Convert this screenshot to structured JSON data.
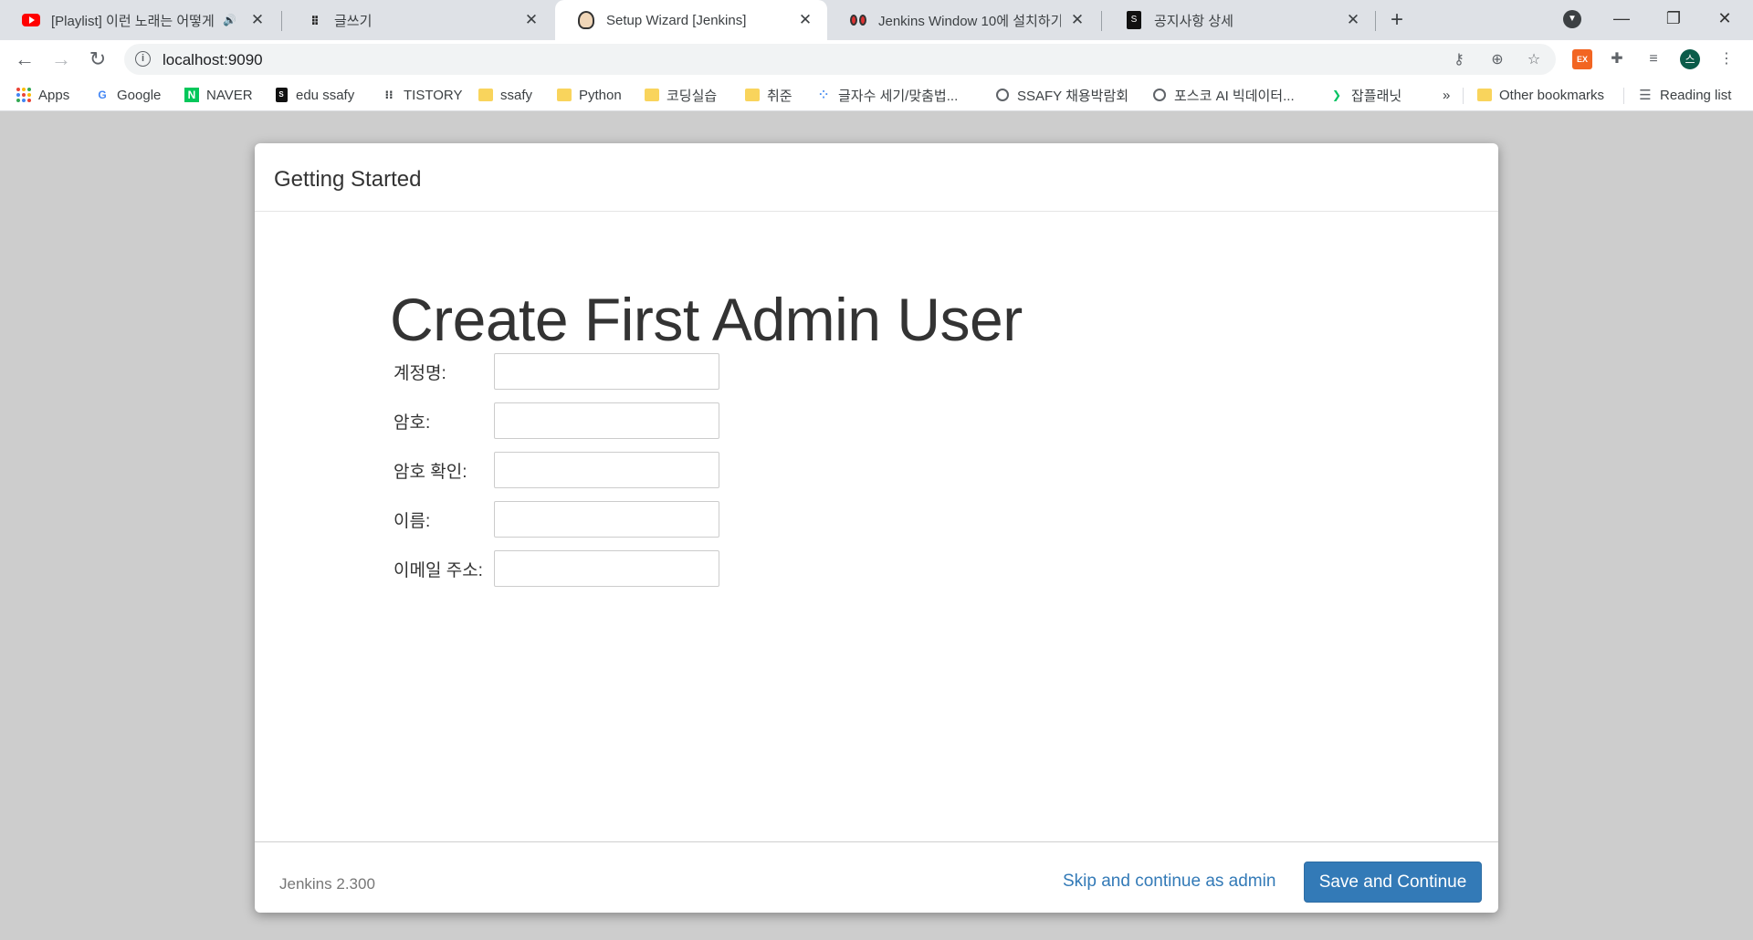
{
  "tabs": [
    {
      "title": "[Playlist] 이런 노래는 어떻게",
      "favicon": "youtube-icon",
      "active": false
    },
    {
      "title": "글쓰기",
      "favicon": "dots-icon",
      "active": false
    },
    {
      "title": "Setup Wizard [Jenkins]",
      "favicon": "jenkins-icon",
      "active": true
    },
    {
      "title": "Jenkins Window 10에 설치하기",
      "favicon": "eyes-icon",
      "active": false
    },
    {
      "title": "공지사항 상세",
      "favicon": "doc-icon",
      "active": false
    }
  ],
  "address_bar": {
    "url": "localhost:9090"
  },
  "bookmarks": [
    {
      "label": "Apps",
      "icon": "apps-grid-icon"
    },
    {
      "label": "Google",
      "icon": "google-icon"
    },
    {
      "label": "NAVER",
      "icon": "naver-icon"
    },
    {
      "label": "edu ssafy",
      "icon": "doc-icon"
    },
    {
      "label": "TISTORY",
      "icon": "dots-icon"
    },
    {
      "label": "ssafy",
      "icon": "folder-icon"
    },
    {
      "label": "Python",
      "icon": "folder-icon"
    },
    {
      "label": "코딩실습",
      "icon": "folder-icon"
    },
    {
      "label": "취준",
      "icon": "folder-icon"
    },
    {
      "label": "글자수 세기/맞춤법...",
      "icon": "dots-color-icon"
    },
    {
      "label": "SSAFY 채용박람회",
      "icon": "globe-icon"
    },
    {
      "label": "포스코 AI 빅데이터...",
      "icon": "globe-icon"
    },
    {
      "label": "잡플래닛",
      "icon": "jobplanet-icon"
    }
  ],
  "bookmarks_overflow": "»",
  "other_bookmarks": "Other bookmarks",
  "reading_list": "Reading list",
  "dialog": {
    "title": "Getting Started",
    "heading": "Create First Admin User",
    "fields": [
      {
        "label": "계정명:",
        "value": ""
      },
      {
        "label": "암호:",
        "value": ""
      },
      {
        "label": "암호 확인:",
        "value": ""
      },
      {
        "label": "이름:",
        "value": ""
      },
      {
        "label": "이메일 주소:",
        "value": ""
      }
    ],
    "version": "Jenkins 2.300",
    "skip_label": "Skip and continue as admin",
    "save_label": "Save and Continue"
  },
  "colors": {
    "primary_button": "#337ab7",
    "link": "#337ab7"
  }
}
